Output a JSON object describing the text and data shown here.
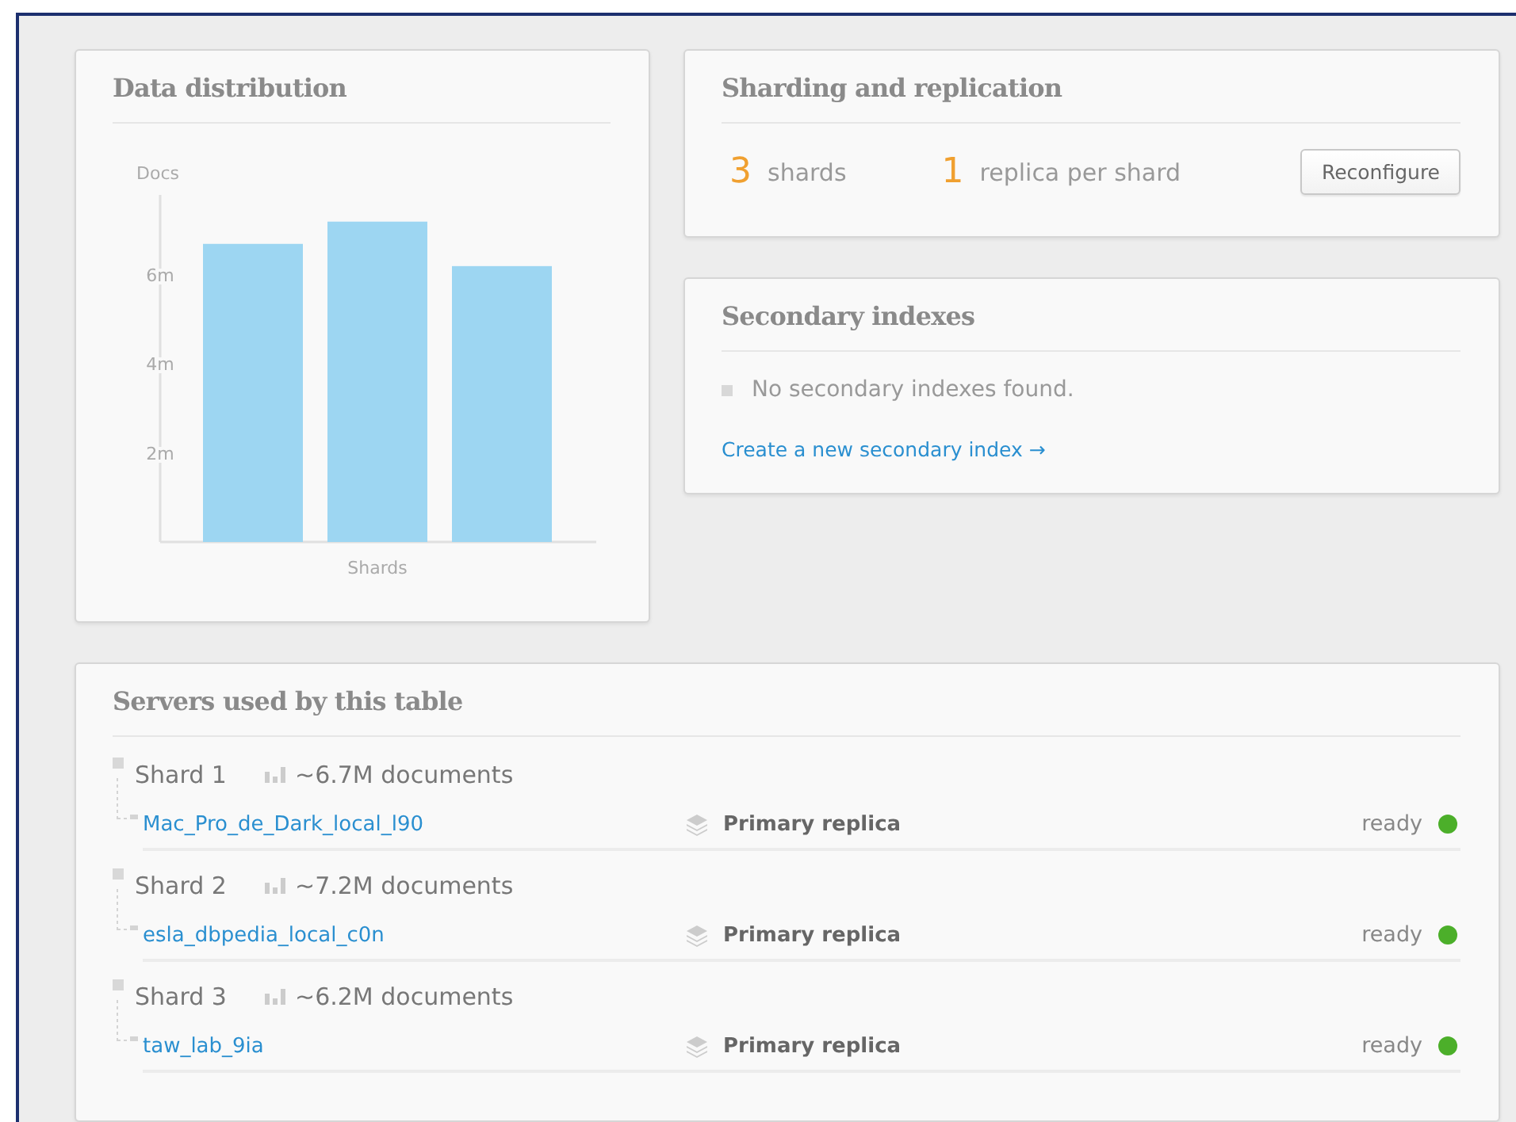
{
  "distribution": {
    "title": "Data distribution",
    "chart_data": {
      "type": "bar",
      "ylabel": "Docs",
      "xlabel": "Shards",
      "values": [
        6.7,
        7.2,
        6.2
      ],
      "ylim": [
        0,
        7.8
      ],
      "yticks": [
        {
          "value": 2,
          "label": "2m"
        },
        {
          "value": 4,
          "label": "4m"
        },
        {
          "value": 6,
          "label": "6m"
        }
      ]
    }
  },
  "sharding": {
    "title": "Sharding and replication",
    "shards_count": "3",
    "shards_label": "shards",
    "replicas_count": "1",
    "replicas_label": "replica per shard",
    "button": "Reconfigure"
  },
  "indexes": {
    "title": "Secondary indexes",
    "empty_message": "No secondary indexes found.",
    "create_link": "Create a new secondary index →"
  },
  "servers": {
    "title": "Servers used by this table",
    "shards": [
      {
        "name": "Shard 1",
        "documents": "~6.7M documents",
        "replicas": [
          {
            "server": "Mac_Pro_de_Dark_local_l90",
            "role": "Primary replica",
            "status": "ready",
            "color": "#4caf2a"
          }
        ]
      },
      {
        "name": "Shard 2",
        "documents": "~7.2M documents",
        "replicas": [
          {
            "server": "esla_dbpedia_local_c0n",
            "role": "Primary replica",
            "status": "ready",
            "color": "#4caf2a"
          }
        ]
      },
      {
        "name": "Shard 3",
        "documents": "~6.2M documents",
        "replicas": [
          {
            "server": "taw_lab_9ia",
            "role": "Primary replica",
            "status": "ready",
            "color": "#4caf2a"
          }
        ]
      }
    ]
  }
}
